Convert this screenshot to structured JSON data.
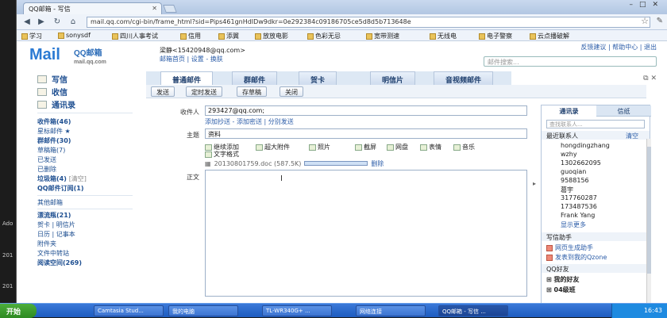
{
  "browser": {
    "tab_title": "QQ邮箱 - 写信",
    "url": "mail.qq.com/cgi-bin/frame_html?sid=Pips461gnHdIDw9dkr=0e292384c09186705ce5d8d5b713648e",
    "bookmarks": [
      "学习",
      "sonysdf",
      "四川人事考试",
      "信用",
      "添翼",
      "放放电影",
      "色彩无忌",
      "宽带测速",
      "无线电",
      "电子警察",
      "云点播破解"
    ]
  },
  "header": {
    "logo_text": "Mail",
    "logo_brand": "QQ邮箱",
    "logo_domain": "mail.qq.com",
    "account": "梁静<15420948@qq.com>",
    "account_links": "邮箱首页 | 设置 - 换肤",
    "top_links": "反馈建议 | 帮助中心 | 退出",
    "search_placeholder": "邮件搜索..."
  },
  "sidebar": {
    "write": "写信",
    "inbox_btn": "收信",
    "contacts_btn": "通讯录",
    "folders": [
      {
        "label": "收件箱(46)",
        "bold": true
      },
      {
        "label": "星标邮件 ★",
        "bold": false
      },
      {
        "label": "群邮件(30)",
        "bold": true
      },
      {
        "label": "草稿箱(7)",
        "bold": false
      },
      {
        "label": "已发送",
        "bold": false
      },
      {
        "label": "已删除",
        "bold": false
      },
      {
        "label": "垃圾箱(4)",
        "bold": true,
        "extra": "[清空]"
      },
      {
        "label": "QQ邮件订阅(1)",
        "bold": true
      },
      {
        "label": "其他邮箱",
        "bold": false
      },
      {
        "label": "漂流瓶(21)",
        "bold": true
      },
      {
        "label": "贺卡 | 明信片",
        "bold": false
      },
      {
        "label": "日历 | 记事本",
        "bold": false
      },
      {
        "label": "附件夹",
        "bold": false
      },
      {
        "label": "文件中转站",
        "bold": false
      },
      {
        "label": "阅读空间(269)",
        "bold": true
      }
    ]
  },
  "compose": {
    "tabs": [
      "普通邮件",
      "群邮件",
      "贺卡",
      "明信片",
      "音视频邮件"
    ],
    "actions": [
      "发送",
      "定时发送",
      "存草稿",
      "关闭"
    ],
    "to_label": "收件人",
    "to_value": "293427@qq.com;",
    "cc_links": "添加抄送 - 添加密送 | 分别发送",
    "subject_label": "主题",
    "subject_value": "资料",
    "tools": [
      "继续添加",
      "超大附件",
      "照片",
      "截屏",
      "网盘",
      "表情",
      "音乐"
    ],
    "text_format": "文字格式",
    "attachment_name": "20130801759.doc (587.5K)",
    "attachment_remove": "删除",
    "body_label": "正文"
  },
  "contacts_panel": {
    "tabs": [
      "通讯录",
      "信纸"
    ],
    "search_placeholder": "查找联系人...",
    "recent_header": "最近联系人",
    "clear_label": "清空",
    "contacts": [
      "hongdingzhang",
      "wzhy",
      "1302662095",
      "guoqian",
      "9588156",
      "葛宇",
      "317760287",
      "173487536",
      "Frank Yang"
    ],
    "show_more": "显示更多",
    "helper_header": "写信助手",
    "helpers": [
      "网页生成助手",
      "发表到我的Qzone"
    ],
    "friends_header": "QQ好友",
    "groups": [
      "我的好友",
      "04级班"
    ]
  },
  "desktop": {
    "side_labels": [
      "Ado",
      "201",
      "201"
    ]
  },
  "taskbar": {
    "start": "开始",
    "tasks": [
      "Camtasia Stud...",
      "我的电脑",
      "TL-WR340G+ ...",
      "网络连接",
      "QQ邮箱 - 写信 ..."
    ],
    "clock": "16:43"
  }
}
